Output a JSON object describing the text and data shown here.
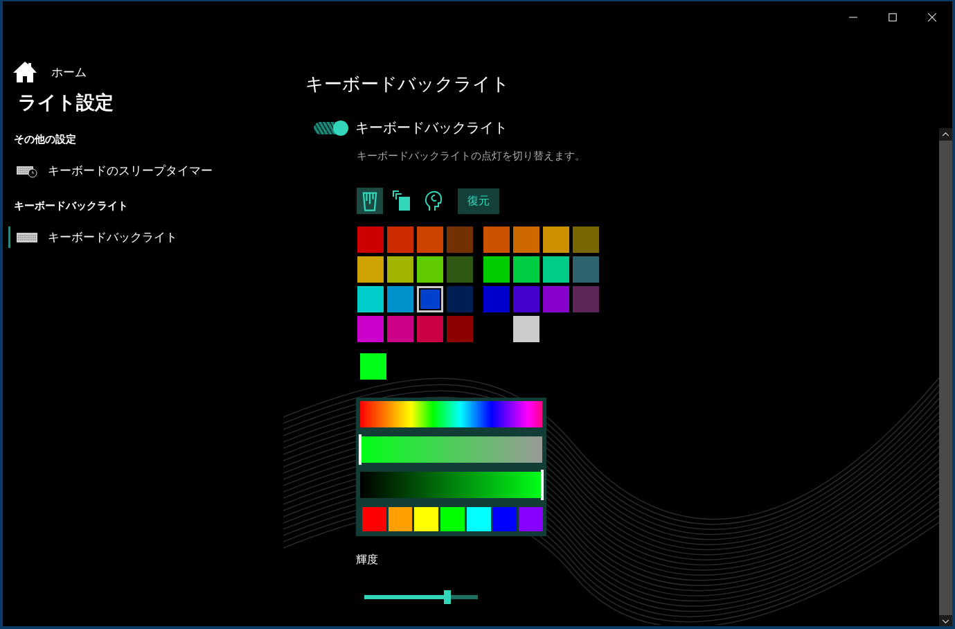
{
  "sidebar": {
    "home": "ホーム",
    "title": "ライト設定",
    "sections": [
      {
        "heading": "その他の設定",
        "items": [
          {
            "label": "キーボードのスリープタイマー",
            "kind": "timer",
            "selected": false
          }
        ]
      },
      {
        "heading": "キーボードバックライト",
        "items": [
          {
            "label": "キーボードバックライト",
            "kind": "keyboard",
            "selected": true
          }
        ]
      }
    ]
  },
  "page": {
    "title": "キーボードバックライト",
    "toggle": {
      "label": "キーボードバックライト",
      "on": true,
      "description": "キーボードバックライトの点灯を切り替えます。"
    },
    "tools": [
      {
        "kind": "bucket",
        "selected": true
      },
      {
        "kind": "copies",
        "selected": false
      },
      {
        "kind": "head",
        "selected": false
      }
    ],
    "restore_button": "復元",
    "palette_left": [
      [
        {
          "kind": "swatch",
          "color": "#cc0000",
          "selected": false
        },
        {
          "kind": "swatch",
          "color": "#cc2a00",
          "selected": false
        },
        {
          "kind": "swatch",
          "color": "#cc4400",
          "selected": false
        },
        {
          "kind": "swatch",
          "color": "#733000",
          "selected": false
        }
      ],
      [
        {
          "kind": "swatch",
          "color": "#cca300",
          "selected": false
        },
        {
          "kind": "swatch",
          "color": "#a3b300",
          "selected": false
        },
        {
          "kind": "swatch",
          "color": "#60cc00",
          "selected": false
        },
        {
          "kind": "swatch",
          "color": "#2f5912",
          "selected": false
        }
      ],
      [
        {
          "kind": "swatch",
          "color": "#00cccc",
          "selected": false
        },
        {
          "kind": "swatch",
          "color": "#0092cc",
          "selected": false
        },
        {
          "kind": "swatch",
          "color": "#0040cc",
          "selected": true
        },
        {
          "kind": "swatch",
          "color": "#001e52",
          "selected": false
        }
      ],
      [
        {
          "kind": "swatch",
          "color": "#cc00cc",
          "selected": false
        },
        {
          "kind": "swatch",
          "color": "#cc0088",
          "selected": false
        },
        {
          "kind": "swatch",
          "color": "#cc0044",
          "selected": false
        },
        {
          "kind": "swatch",
          "color": "#8c0000",
          "selected": false
        }
      ]
    ],
    "palette_right": [
      [
        {
          "kind": "swatch",
          "color": "#cc5200",
          "selected": false
        },
        {
          "kind": "swatch",
          "color": "#cc6a00",
          "selected": false
        },
        {
          "kind": "swatch",
          "color": "#cc9000",
          "selected": false
        },
        {
          "kind": "swatch",
          "color": "#7a6600",
          "selected": false
        }
      ],
      [
        {
          "kind": "swatch",
          "color": "#00cc00",
          "selected": false
        },
        {
          "kind": "swatch",
          "color": "#00cc44",
          "selected": false
        },
        {
          "kind": "swatch",
          "color": "#00cc88",
          "selected": false
        },
        {
          "kind": "swatch",
          "color": "#2e6370",
          "selected": false
        }
      ],
      [
        {
          "kind": "swatch",
          "color": "#0000cc",
          "selected": false
        },
        {
          "kind": "swatch",
          "color": "#4400cc",
          "selected": false
        },
        {
          "kind": "swatch",
          "color": "#8800cc",
          "selected": false
        },
        {
          "kind": "swatch",
          "color": "#5c2656",
          "selected": false
        }
      ],
      [
        {
          "kind": "empty"
        },
        {
          "kind": "swatch",
          "color": "#cccccc",
          "selected": false
        }
      ]
    ],
    "custom_colors": [
      {
        "color": "#00ff18"
      }
    ],
    "saturation": {
      "level": 0
    },
    "brightness_bar": {
      "level": 1
    },
    "presets": [
      {
        "color": "#ff0000"
      },
      {
        "color": "#ffa000"
      },
      {
        "color": "#ffff00"
      },
      {
        "color": "#00ff00"
      },
      {
        "color": "#00ffff"
      },
      {
        "color": "#0000ff"
      },
      {
        "color": "#8800ff"
      }
    ],
    "brightness": {
      "label": "輝度",
      "level": 0.73
    }
  }
}
